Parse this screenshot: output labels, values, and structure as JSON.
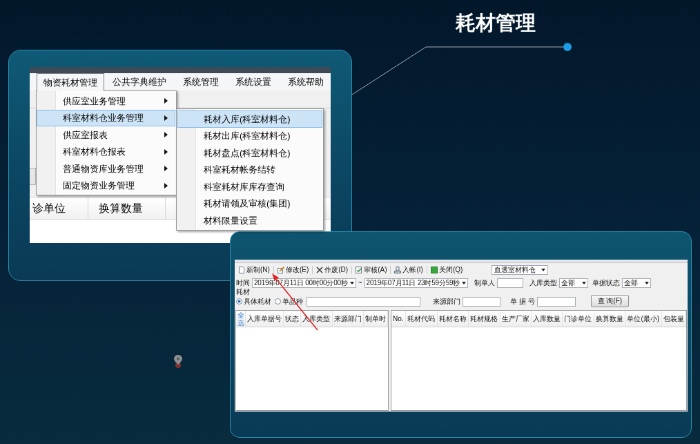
{
  "title": "耗材管理",
  "menu_screenshot": {
    "menubar": [
      {
        "label": "物资耗材管理",
        "selected": true
      },
      {
        "label": "公共字典维护",
        "selected": false
      },
      {
        "label": "系统管理",
        "selected": false
      },
      {
        "label": "系统设置",
        "selected": false
      },
      {
        "label": "系统帮助",
        "selected": false
      }
    ],
    "menu": [
      {
        "label": "供应室业务管理",
        "selected": false,
        "has_submenu": true
      },
      {
        "label": "科室材料仓业务管理",
        "selected": true,
        "has_submenu": true
      },
      {
        "label": "供应室报表",
        "selected": false,
        "has_submenu": true
      },
      {
        "label": "科室材料仓报表",
        "selected": false,
        "has_submenu": true
      },
      {
        "label": "普通物资库业务管理",
        "selected": false,
        "has_submenu": true
      },
      {
        "label": "固定物资业务管理",
        "selected": false,
        "has_submenu": true
      }
    ],
    "submenu": [
      {
        "label": "耗材入库(科室材料仓)",
        "selected": true
      },
      {
        "label": "耗材出库(科室材料仓)",
        "selected": false
      },
      {
        "label": "耗材盘点(科室材料仓)",
        "selected": false
      },
      {
        "label": "科室耗材帐务结转",
        "selected": false
      },
      {
        "label": "科室耗材库库存查询",
        "selected": false
      },
      {
        "label": "耗材请领及审核(集团)",
        "selected": false
      },
      {
        "label": "材料限量设置",
        "selected": false
      }
    ],
    "table_columns": [
      "诊单位",
      "换算数量"
    ]
  },
  "form_screenshot": {
    "toolbar": [
      {
        "label": "新制(N)",
        "kind": "new"
      },
      {
        "label": "修改(E)",
        "kind": "edit"
      },
      {
        "label": "作废(D)",
        "kind": "void"
      },
      {
        "label": "审核(A)",
        "kind": "audit"
      },
      {
        "label": "入帐(I)",
        "kind": "post"
      },
      {
        "label": "关闭(Q)",
        "kind": "close"
      }
    ],
    "warehouse": "血透室材料仓",
    "time_label": "时间",
    "time_from": "2019年07月11日 00时00分00秒",
    "range_separator": "~",
    "time_to": "2019年07月11日 23时59分59秒",
    "maker": {
      "label": "制单人"
    },
    "entry_type": {
      "label": "入库类型",
      "value": "全部"
    },
    "doc_status": {
      "label": "单据状态",
      "value": "全部"
    },
    "material_label": "耗材",
    "radios": [
      {
        "label": "具体耗材",
        "selected": true
      },
      {
        "label": "单品种",
        "selected": false
      }
    ],
    "source_dept": {
      "label": "来源部门"
    },
    "doc_no": {
      "label": "单 据 号"
    },
    "query_button": "查 询(F)",
    "left_table": {
      "select_all": "全选",
      "columns": [
        "入库单据号",
        "状态",
        "入库类型",
        "来源部门",
        "制单时"
      ]
    },
    "right_table": {
      "columns": [
        "No.",
        "耗材代码",
        "耗材名称",
        "耗材规格",
        "生产厂家",
        "入库数量",
        "门诊单位",
        "换算数量",
        "单位(最小)",
        "包装量"
      ]
    }
  }
}
